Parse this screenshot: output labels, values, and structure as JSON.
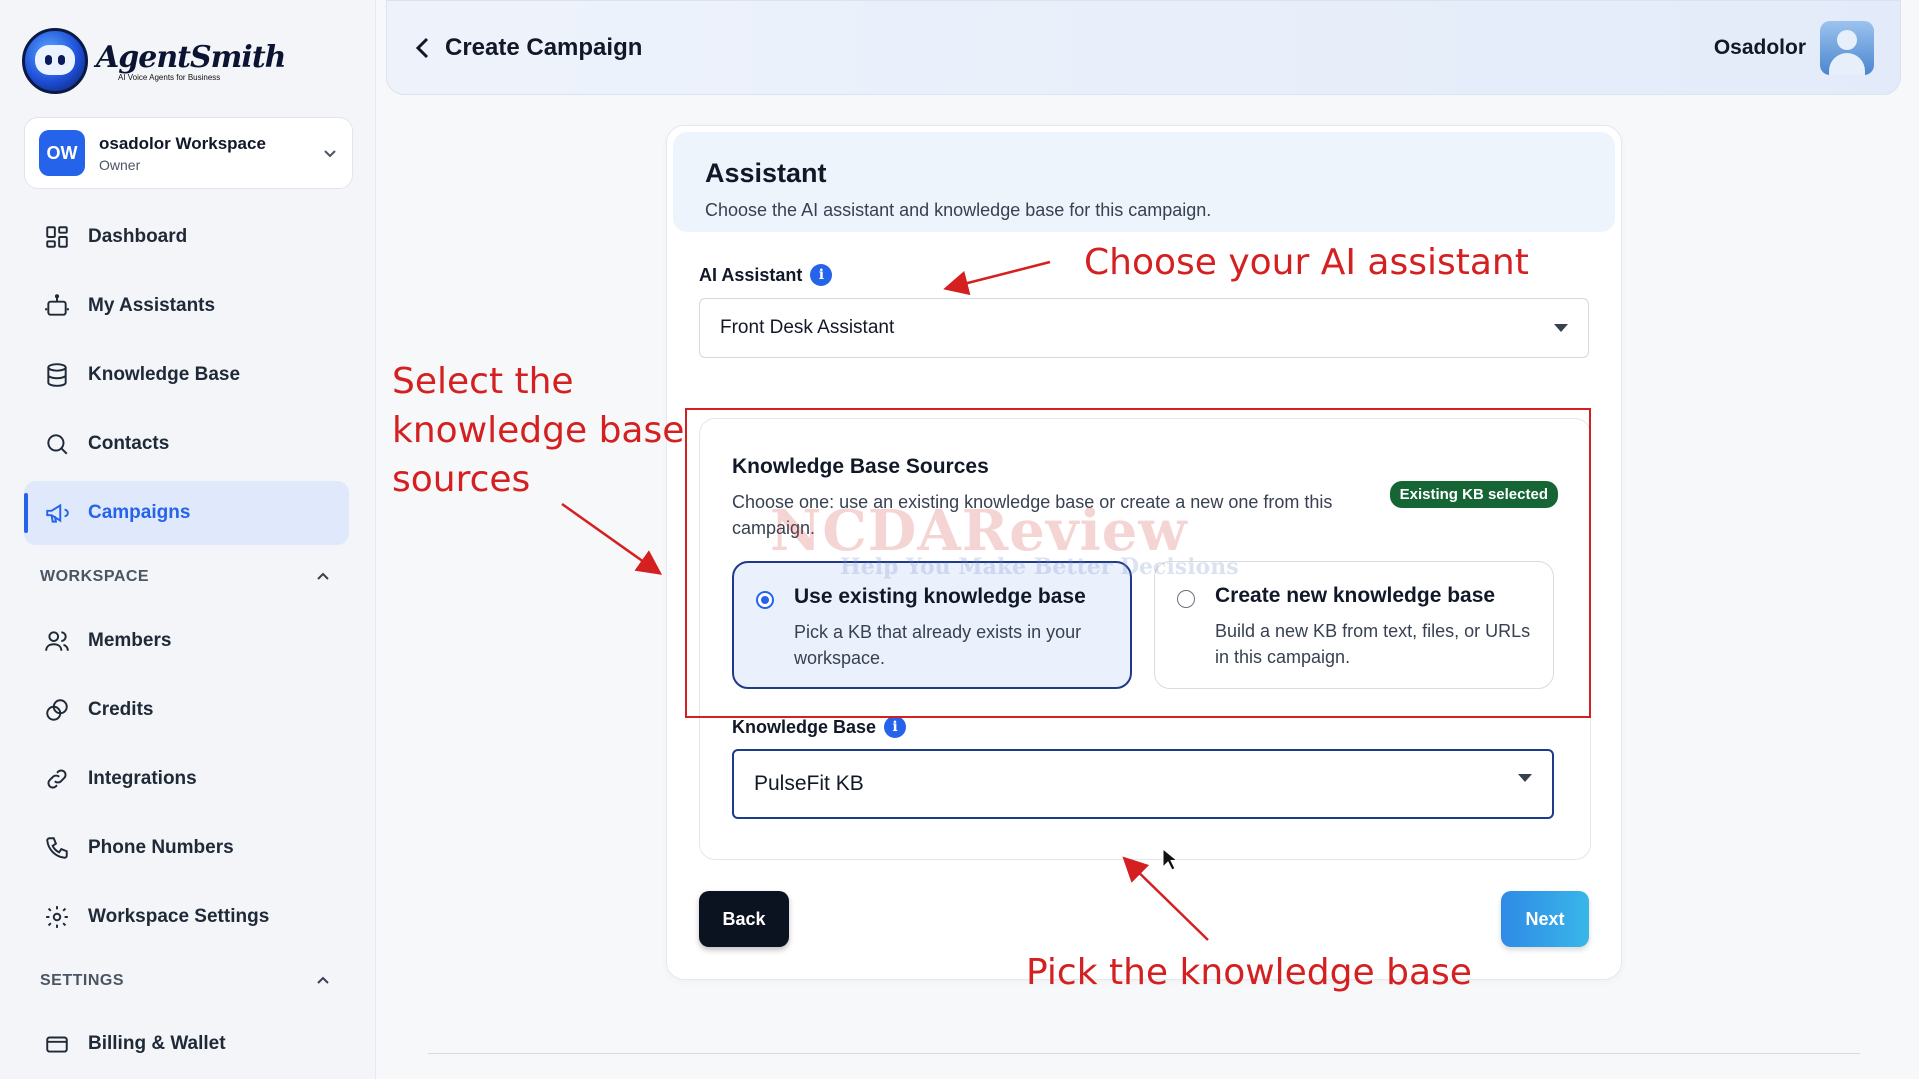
{
  "app": {
    "brand_name": "AgentSmith",
    "brand_tagline": "AI Voice Agents for Business"
  },
  "workspace": {
    "initials": "OW",
    "name": "osadolor Workspace",
    "role": "Owner"
  },
  "nav": {
    "main": [
      {
        "label": "Dashboard",
        "icon": "grid-icon"
      },
      {
        "label": "My Assistants",
        "icon": "robot-icon"
      },
      {
        "label": "Knowledge Base",
        "icon": "database-icon"
      },
      {
        "label": "Contacts",
        "icon": "search-icon"
      },
      {
        "label": "Campaigns",
        "icon": "megaphone-icon",
        "active": true
      }
    ],
    "workspace_section": "WORKSPACE",
    "workspace_items": [
      {
        "label": "Members",
        "icon": "users-icon"
      },
      {
        "label": "Credits",
        "icon": "coins-icon"
      },
      {
        "label": "Integrations",
        "icon": "link-icon"
      },
      {
        "label": "Phone Numbers",
        "icon": "phone-icon"
      },
      {
        "label": "Workspace Settings",
        "icon": "gear-icon"
      }
    ],
    "settings_section": "SETTINGS",
    "settings_items": [
      {
        "label": "Billing & Wallet",
        "icon": "wallet-icon"
      }
    ]
  },
  "header": {
    "title": "Create Campaign",
    "user_name": "Osadolor"
  },
  "card": {
    "title": "Assistant",
    "subtitle": "Choose the AI assistant and knowledge base for this campaign.",
    "assistant_label": "AI Assistant",
    "assistant_value": "Front Desk Assistant",
    "kb_sources": {
      "title": "Knowledge Base Sources",
      "description": "Choose one: use an existing knowledge base or create a new one from this campaign.",
      "badge": "Existing KB selected",
      "options": [
        {
          "title": "Use existing knowledge base",
          "description": "Pick a KB that already exists in your workspace.",
          "selected": true
        },
        {
          "title": "Create new knowledge base",
          "description": "Build a new KB from text, files, or URLs in this campaign.",
          "selected": false
        }
      ]
    },
    "kb_label": "Knowledge Base",
    "kb_value": "PulseFit KB",
    "back_label": "Back",
    "next_label": "Next"
  },
  "annotations": {
    "choose_assistant": "Choose your AI assistant",
    "select_sources_1": "Select the",
    "select_sources_2": "knowledge base",
    "select_sources_3": "sources",
    "pick_kb": "Pick the knowledge base"
  },
  "watermark": {
    "main": "NCDAReview",
    "sub": "Help You Make Better Decisions"
  },
  "colors": {
    "accent": "#2563eb",
    "annotation_red": "#d42020",
    "badge_green": "#166534"
  }
}
